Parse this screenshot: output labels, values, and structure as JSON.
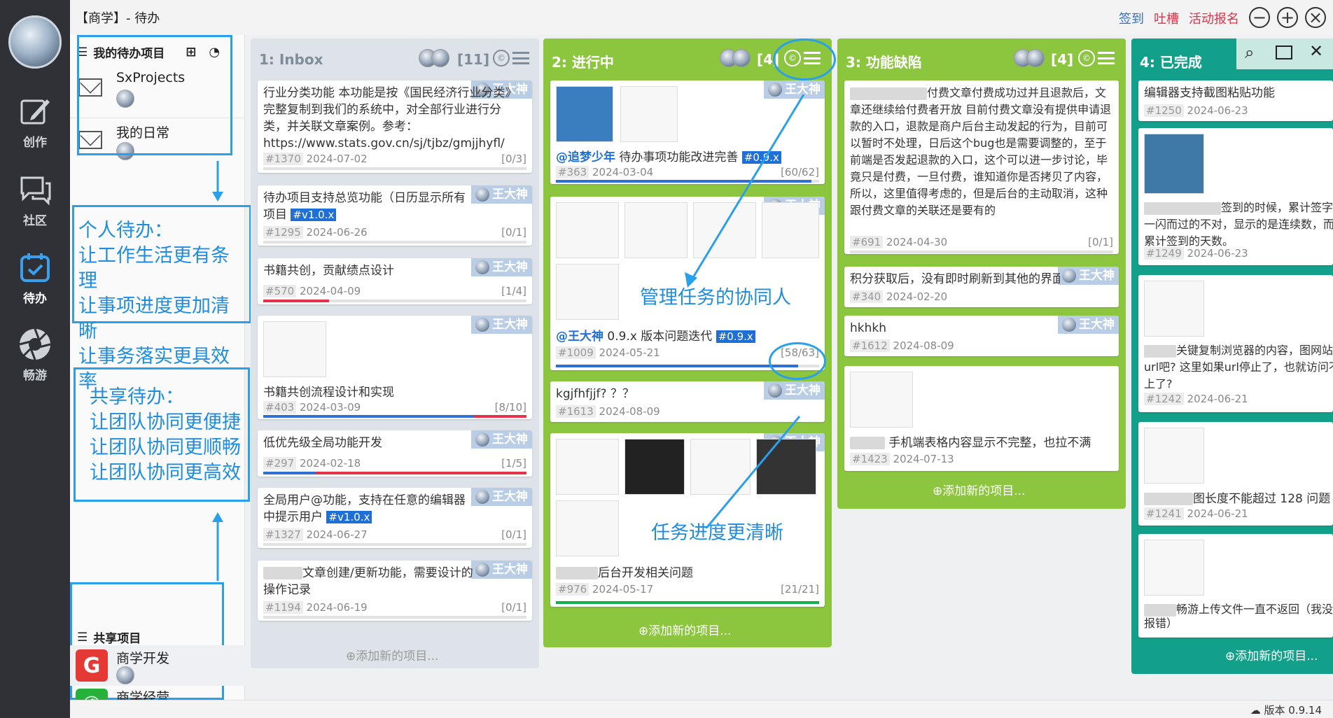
{
  "window": {
    "title": "【商学】- 待办"
  },
  "header": {
    "links": [
      "签到",
      "吐槽",
      "活动报名"
    ],
    "buttons": [
      "−",
      "+",
      "×"
    ]
  },
  "nav": [
    {
      "label": "创作",
      "icon": "edit-icon"
    },
    {
      "label": "社区",
      "icon": "chat-icon"
    },
    {
      "label": "待办",
      "icon": "calendar-check-icon"
    },
    {
      "label": "畅游",
      "icon": "aperture-icon"
    }
  ],
  "sidebar": {
    "my_title": "我的待办项目",
    "my_projects": [
      "SxProjects",
      "我的日常"
    ],
    "shared_title": "共享项目",
    "shared_projects": [
      "商学开发",
      "商学经营"
    ],
    "annot_personal": [
      "个人待办：",
      "让工作生活更有条理",
      "让事项进度更加清晰",
      "让事务落实更具效率"
    ],
    "annot_shared": [
      "共享待办：",
      "让团队协同更便捷",
      "让团队协同更顺畅",
      "让团队协同更高效"
    ]
  },
  "assignee_name": "王大神",
  "add_item_label": "⊕添加新的项目...",
  "columns": [
    {
      "title": "1:  Inbox",
      "count": "[11]"
    },
    {
      "title": "2:  进行中",
      "count": "[4]"
    },
    {
      "title": "3:  功能缺陷",
      "count": "[4]"
    },
    {
      "title": "4:  已完成",
      "count": ""
    }
  ],
  "inbox_cards": [
    {
      "text": "行业分类功能 本功能是按《国民经济行业分类》完整复制到我们的系统中，对全部行业进行分类，并关联文章案例。参考：https://www.stats.gov.cn/sj/tjbz/gmjjhyfl/",
      "id": "#1370",
      "date": "2024-07-02",
      "progress": "[0/3]",
      "fraction": 0
    },
    {
      "text": "待办项目支持总览功能（日历显示所有项目",
      "tag": "#v1.0.x",
      "id": "#1295",
      "date": "2024-06-26",
      "progress": "[0/1]",
      "fraction": 0
    },
    {
      "text": "书籍共创，贡献绩点设计",
      "id": "#570",
      "date": "2024-04-09",
      "progress": "[1/4]",
      "fraction": 0.25
    },
    {
      "text": "书籍共创流程设计和实现",
      "id": "#403",
      "date": "2024-03-09",
      "progress": "[8/10]",
      "fraction": 0.8
    },
    {
      "text": "低优先级全局功能开发",
      "id": "#297",
      "date": "2024-02-18",
      "progress": "[1/5]",
      "fraction": 0.2
    },
    {
      "text": "全局用户@功能，支持在任意的编辑器中提示用户",
      "tag": "#v1.0.x",
      "id": "#1327",
      "date": "2024-06-27",
      "progress": "[0/1]",
      "fraction": 0
    },
    {
      "text": "文章创建/更新功能，需要设计的操作记录",
      "id": "#1194",
      "date": "2024-06-19",
      "progress": "[0/1]",
      "fraction": 0
    }
  ],
  "progress_cards": [
    {
      "mention": "@追梦少年",
      "text": "待办事项功能改进完善",
      "tag": "#0.9.x",
      "id": "#363",
      "date": "2024-03-04",
      "progress": "[60/62]",
      "fraction": 0.97
    },
    {
      "mention": "@王大神",
      "text": "0.9.x 版本问题迭代",
      "tag": "#0.9.x",
      "id": "#1009",
      "date": "2024-05-21",
      "progress": "[58/63]",
      "fraction": 0.92
    },
    {
      "text": "kgjfhfjjf? ？？",
      "id": "#1613",
      "date": "2024-08-09",
      "progress": "",
      "fraction": 0
    },
    {
      "text": "后台开发相关问题",
      "id": "#976",
      "date": "2024-05-17",
      "progress": "[21/21]",
      "fraction": 1
    }
  ],
  "progress_annotations": [
    "管理任务的协同人",
    "任务进度更清晰"
  ],
  "bug_cards": [
    {
      "text": "付费文章付费成功过并且退款后，文章还继续给付费者开放 目前付费文章没有提供申请退款的入口，退款是商户后台主动发起的行为，目前可以暂时不处理，日后这个bug也是需要调整的，至于前端是否发起退款的入口，这个可以进一步讨论，毕竟只是付费，一旦付费，谁知道你是否拷贝了内容，所以，这里值得考虑的，但是后台的主动取消，这种跟付费文章的关联还是要有的",
      "id": "#691",
      "date": "2024-04-30",
      "progress": "[0/1]",
      "fraction": 0
    },
    {
      "text": "积分获取后，没有即时刷新到其他的界面",
      "id": "#340",
      "date": "2024-02-20",
      "progress": "",
      "fraction": 0
    },
    {
      "text": "hkhkh",
      "id": "#1612",
      "date": "2024-08-09",
      "progress": "",
      "fraction": 0
    },
    {
      "text": "手机端表格内容显示不完整，也拉不满",
      "id": "#1423",
      "date": "2024-07-13",
      "progress": "",
      "fraction": 0
    }
  ],
  "done_cards": [
    {
      "text": "编辑器支持截图粘贴功能",
      "id": "#1250",
      "date": "2024-06-23"
    },
    {
      "text": "签到的时候，累计签字有一闪而过的不对，显示的是连续数，而非累计签到的天数。",
      "id": "#1249",
      "date": "2024-06-23"
    },
    {
      "text": "关键复制浏览器的内容，图网站的url吧? 这里如果url停止了，也就访问不上了?",
      "id": "#1242",
      "date": "2024-06-21"
    },
    {
      "text": "图长度不能超过 128 问题",
      "id": "#1241",
      "date": "2024-06-21"
    },
    {
      "text": "畅游上传文件一直不返回（我没有报错）",
      "id": "",
      "date": ""
    }
  ],
  "statusbar": {
    "version": "版本 0.9.14"
  },
  "colors": {
    "rail": "#2f3136",
    "accent": "#2aa0ea",
    "progress_col": "#8cc63f",
    "done_col": "#12a08a",
    "red": "#e2334b",
    "tag": "#1f6fd8"
  }
}
